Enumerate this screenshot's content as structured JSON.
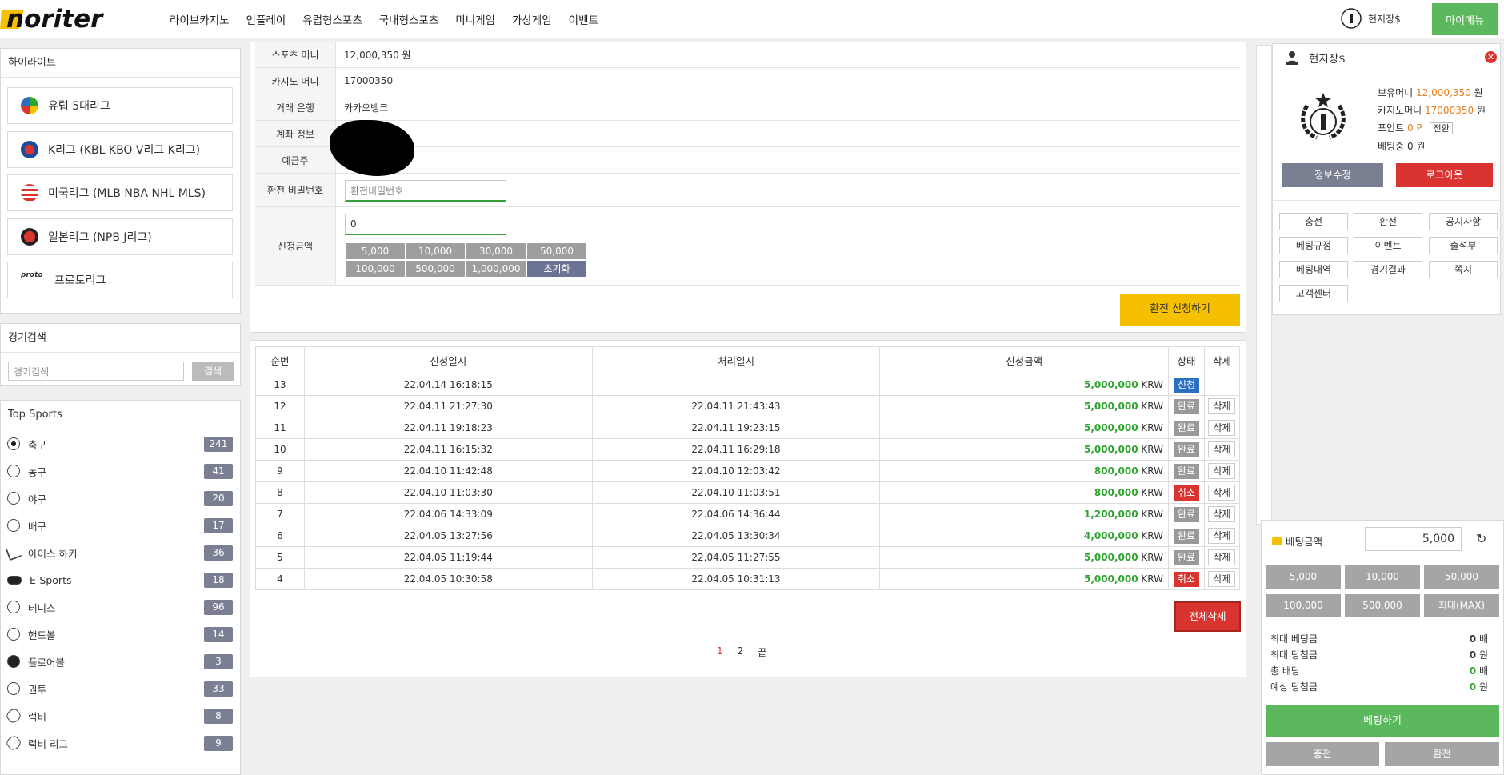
{
  "logo_text": "noriter",
  "nav": [
    "라이브카지노",
    "인플레이",
    "유럽형스포츠",
    "국내형스포츠",
    "미니게임",
    "가상게임",
    "이벤트"
  ],
  "user": {
    "name": "현지장$",
    "my_menu": "마이메뉴"
  },
  "sidebar": {
    "highlight_title": "하이라이트",
    "leagues": [
      "유럽 5대리그",
      "K리그 (KBL KBO V리그 K리그)",
      "미국리그 (MLB NBA NHL MLS)",
      "일본리그 (NPB J리그)",
      "프로토리그"
    ],
    "search_title": "경기검색",
    "search_placeholder": "경기검색",
    "search_button": "검색",
    "top_sports_title": "Top Sports",
    "sports": [
      {
        "name": "축구",
        "count": "241"
      },
      {
        "name": "농구",
        "count": "41"
      },
      {
        "name": "야구",
        "count": "20"
      },
      {
        "name": "배구",
        "count": "17"
      },
      {
        "name": "아이스 하키",
        "count": "36"
      },
      {
        "name": "E-Sports",
        "count": "18"
      },
      {
        "name": "테니스",
        "count": "96"
      },
      {
        "name": "핸드볼",
        "count": "14"
      },
      {
        "name": "플로어볼",
        "count": "3"
      },
      {
        "name": "권투",
        "count": "33"
      },
      {
        "name": "럭비",
        "count": "8"
      },
      {
        "name": "럭비 리그",
        "count": "9"
      }
    ]
  },
  "form": {
    "sports_money_label": "스포츠 머니",
    "sports_money": "12,000,350 원",
    "casino_money_label": "카지노 머니",
    "casino_money": "17000350",
    "bank_label": "거래 은행",
    "bank": "카카오뱅크",
    "account_label": "계좌 정보",
    "holder_label": "예금주",
    "password_label": "환전 비밀번호",
    "password_placeholder": "환전비밀번호",
    "amount_label": "신청금액",
    "amount_value": "0",
    "amount_buttons": [
      "5,000",
      "10,000",
      "30,000",
      "50,000",
      "100,000",
      "500,000",
      "1,000,000"
    ],
    "reset_button": "초기화",
    "submit_button": "환전 신청하기"
  },
  "table": {
    "headers": [
      "순번",
      "신청일시",
      "처리일시",
      "신청금액",
      "상태",
      "삭제"
    ],
    "rows": [
      {
        "no": "13",
        "req": "22.04.14 16:18:15",
        "proc": "",
        "amount": "5,000,000",
        "status": "신청",
        "del": ""
      },
      {
        "no": "12",
        "req": "22.04.11 21:27:30",
        "proc": "22.04.11 21:43:43",
        "amount": "5,000,000",
        "status": "완료",
        "del": "삭제"
      },
      {
        "no": "11",
        "req": "22.04.11 19:18:23",
        "proc": "22.04.11 19:23:15",
        "amount": "5,000,000",
        "status": "완료",
        "del": "삭제"
      },
      {
        "no": "10",
        "req": "22.04.11 16:15:32",
        "proc": "22.04.11 16:29:18",
        "amount": "5,000,000",
        "status": "완료",
        "del": "삭제"
      },
      {
        "no": "9",
        "req": "22.04.10 11:42:48",
        "proc": "22.04.10 12:03:42",
        "amount": "800,000",
        "status": "완료",
        "del": "삭제"
      },
      {
        "no": "8",
        "req": "22.04.10 11:03:30",
        "proc": "22.04.10 11:03:51",
        "amount": "800,000",
        "status": "취소",
        "del": "삭제"
      },
      {
        "no": "7",
        "req": "22.04.06 14:33:09",
        "proc": "22.04.06 14:36:44",
        "amount": "1,200,000",
        "status": "완료",
        "del": "삭제"
      },
      {
        "no": "6",
        "req": "22.04.05 13:27:56",
        "proc": "22.04.05 13:30:34",
        "amount": "4,000,000",
        "status": "완료",
        "del": "삭제"
      },
      {
        "no": "5",
        "req": "22.04.05 11:19:44",
        "proc": "22.04.05 11:27:55",
        "amount": "5,000,000",
        "status": "완료",
        "del": "삭제"
      },
      {
        "no": "4",
        "req": "22.04.05 10:30:58",
        "proc": "22.04.05 10:31:13",
        "amount": "5,000,000",
        "status": "취소",
        "del": "삭제"
      }
    ],
    "currency": "KRW",
    "delete_all": "전체삭제",
    "pages": [
      "1",
      "2"
    ],
    "last_page": "끝"
  },
  "mymenu": {
    "name": "현지장$",
    "hold_money_label": "보유머니",
    "hold_money": "12,000,350",
    "won": "원",
    "casino_money_label": "카지노머니",
    "casino_money": "17000350",
    "point_label": "포인트",
    "point": "0 P",
    "convert": "전환",
    "betting_label": "베팅중",
    "betting": "0 원",
    "edit_button": "정보수정",
    "logout_button": "로그아웃",
    "menu": [
      "충전",
      "환전",
      "공지사항",
      "베팅규정",
      "이벤트",
      "출석부",
      "베팅내역",
      "경기결과",
      "쪽지",
      "고객센터"
    ]
  },
  "betslip": {
    "amount_label": "베팅금액",
    "amount": "5,000",
    "buttons": [
      "5,000",
      "10,000",
      "50,000",
      "100,000",
      "500,000",
      "최대(MAX)"
    ],
    "summary": [
      {
        "label": "최대 베팅금",
        "value": "0",
        "unit": "배"
      },
      {
        "label": "최대 당첨금",
        "value": "0",
        "unit": "원"
      },
      {
        "label": "총 배당",
        "value": "0",
        "unit": "배"
      },
      {
        "label": "예상 당첨금",
        "value": "0",
        "unit": "원"
      }
    ],
    "bet_button": "베팅하기",
    "deposit_button": "충전",
    "withdraw_button": "환전"
  },
  "colors": {
    "accent_green": "#5cb85c",
    "accent_orange": "#e67e22",
    "submit_yellow": "#f5c000",
    "danger_red": "#d9342f"
  }
}
